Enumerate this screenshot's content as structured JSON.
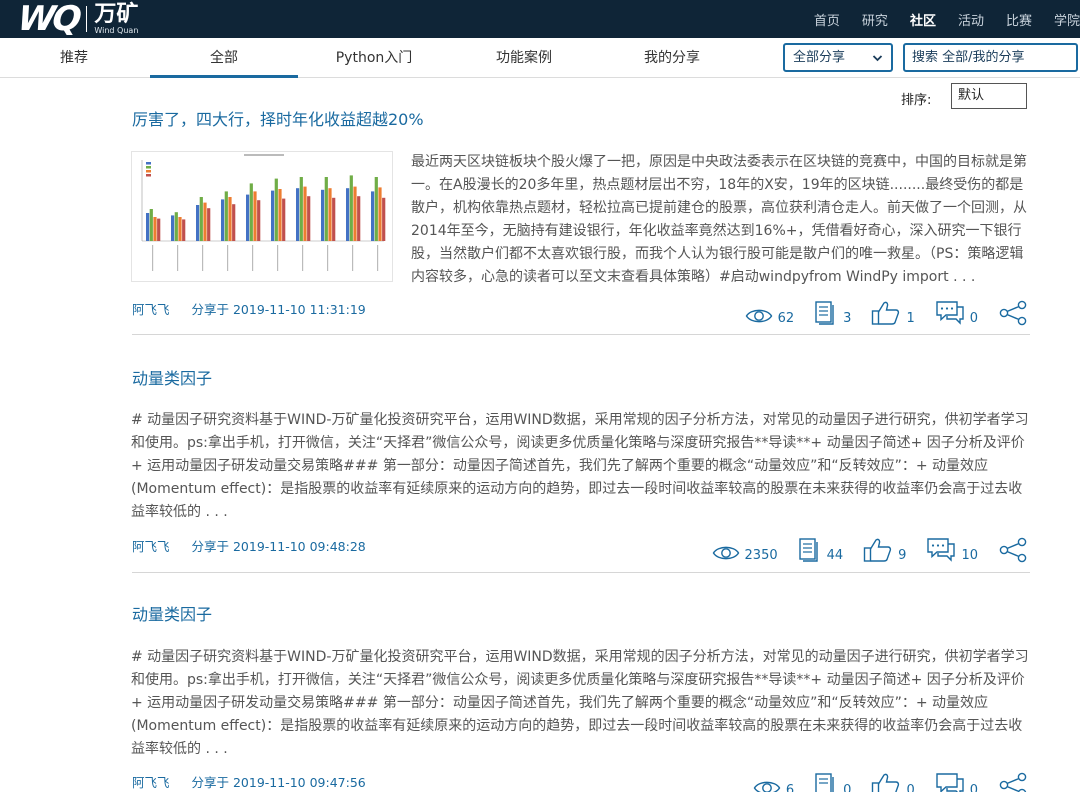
{
  "brand": {
    "mark": "WQ",
    "name_cn": "万矿",
    "name_en": "Wind Quan"
  },
  "topnav": [
    "首页",
    "研究",
    "社区",
    "活动",
    "比赛",
    "学院"
  ],
  "topnav_active": "社区",
  "tabs": [
    "推荐",
    "全部",
    "Python入门",
    "功能案例",
    "我的分享"
  ],
  "tab_active": "全部",
  "filter": {
    "value": "全部分享"
  },
  "search": {
    "placeholder": "搜索 全部/我的分享"
  },
  "sort": {
    "label": "排序:",
    "value": "默认"
  },
  "posts": [
    {
      "title": "厉害了，四大行，择时年化收益超越20%",
      "excerpt": "最近两天区块链板块个股火爆了一把，原因是中央政法委表示在区块链的竞赛中，中国的目标就是第一。在A股漫长的20多年里，热点题材层出不穷，18年的X安，19年的区块链........最终受伤的都是散户，机构依靠热点题材，轻松拉高已提前建仓的股票，高位获利清仓走人。前天做了一个回测，从2014年至今，无脑持有建设银行，年化收益率竟然达到16%+，凭借看好奇心，深入研究一下银行股，当然散户们都不太喜欢银行股，而我个人认为银行股可能是散户们的唯一救星。（PS：策略逻辑内容较多，心急的读者可以至文末查看具体策略）#启动windpyfrom WindPy import . . .",
      "author": "阿飞飞",
      "shared": "分享于 2019-11-10 11:31:19",
      "views": "62",
      "comments": "3",
      "likes": "1",
      "replies": "0"
    },
    {
      "title": "动量类因子",
      "excerpt": "# 动量因子研究资料基于WIND-万矿量化投资研究平台，运用WIND数据，采用常规的因子分析方法，对常见的动量因子进行研究，供初学者学习和使用。ps:拿出手机，打开微信，关注“天择君”微信公众号，阅读更多优质量化策略与深度研究报告**导读**+ 动量因子简述+ 因子分析及评价+ 运用动量因子研发动量交易策略### 第一部分：动量因子简述首先，我们先了解两个重要的概念“动量效应”和“反转效应”：+ 动量效应(Momentum effect)：是指股票的收益率有延续原来的运动方向的趋势，即过去一段时间收益率较高的股票在未来获得的收益率仍会高于过去收益率较低的 . . .",
      "author": "阿飞飞",
      "shared": "分享于 2019-11-10 09:48:28",
      "views": "2350",
      "comments": "44",
      "likes": "9",
      "replies": "10"
    },
    {
      "title": "动量类因子",
      "excerpt": "# 动量因子研究资料基于WIND-万矿量化投资研究平台，运用WIND数据，采用常规的因子分析方法，对常见的动量因子进行研究，供初学者学习和使用。ps:拿出手机，打开微信，关注“天择君”微信公众号，阅读更多优质量化策略与深度研究报告**导读**+ 动量因子简述+ 因子分析及评价+ 运用动量因子研发动量交易策略### 第一部分：动量因子简述首先，我们先了解两个重要的概念“动量效应”和“反转效应”：+ 动量效应(Momentum effect)：是指股票的收益率有延续原来的运动方向的趋势，即过去一段时间收益率较高的股票在未来获得的收益率仍会高于过去收益率较低的 . . .",
      "author": "阿飞飞",
      "shared": "分享于 2019-11-10 09:47:56",
      "views": "6",
      "comments": "0",
      "likes": "0",
      "replies": "0"
    }
  ],
  "icons": {
    "views": "eye-icon",
    "comments": "document-icon",
    "likes": "thumbs-up-icon",
    "replies": "chat-icon",
    "share": "share-icon"
  },
  "colors": {
    "topbar": "#0f2537",
    "accent": "#1a6aa0",
    "thumb_bar_1": "#4472c4",
    "thumb_bar_2": "#70ad47",
    "thumb_bar_3": "#ed7d31",
    "thumb_bar_4": "#c0504d"
  },
  "thumb_groups": [
    [
      0.35,
      0.4,
      0.3,
      0.28
    ],
    [
      0.32,
      0.36,
      0.3,
      0.27
    ],
    [
      0.45,
      0.55,
      0.48,
      0.41
    ],
    [
      0.52,
      0.62,
      0.55,
      0.46
    ],
    [
      0.58,
      0.72,
      0.62,
      0.51
    ],
    [
      0.63,
      0.78,
      0.65,
      0.53
    ],
    [
      0.66,
      0.8,
      0.68,
      0.56
    ],
    [
      0.64,
      0.8,
      0.66,
      0.54
    ],
    [
      0.66,
      0.82,
      0.68,
      0.56
    ],
    [
      0.62,
      0.8,
      0.67,
      0.54
    ]
  ]
}
